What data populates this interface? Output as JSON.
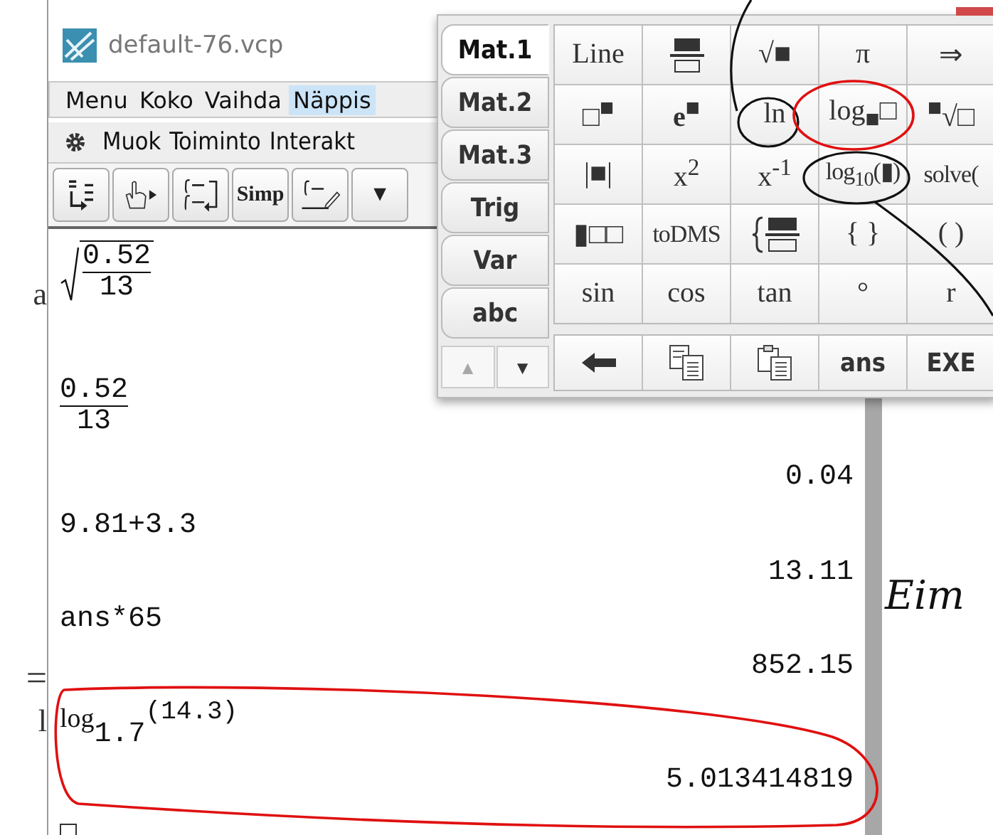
{
  "background_text": [
    {
      "text": "a"
    },
    {
      "text": "="
    },
    {
      "text": "l"
    }
  ],
  "window": {
    "title": "default-76.vcp"
  },
  "menu": [
    {
      "label": "Menu",
      "selected": false
    },
    {
      "label": "Koko",
      "selected": false
    },
    {
      "label": "Vaihda",
      "selected": false
    },
    {
      "label": "Näppis",
      "selected": true
    }
  ],
  "toolbar_menu": [
    "Muok",
    "Toiminto",
    "Interakt"
  ],
  "toolbar": [
    {
      "kind": "convert"
    },
    {
      "kind": "hand"
    },
    {
      "kind": "integral_swap"
    },
    {
      "kind": "text",
      "label": "Simp"
    },
    {
      "kind": "integral_pen"
    },
    {
      "kind": "text",
      "label": "▼"
    }
  ],
  "work_area": [
    {
      "kind": "sqrt_frac",
      "num": "0.52",
      "den": "13"
    },
    {
      "kind": "frac",
      "num": "0.52",
      "den": "13"
    },
    {
      "kind": "result",
      "text": "0.04"
    },
    {
      "kind": "input",
      "text": "9.81+3.3"
    },
    {
      "kind": "result",
      "text": "13.11"
    },
    {
      "kind": "input",
      "text": "ans*65"
    },
    {
      "kind": "result",
      "text": "852.15"
    },
    {
      "kind": "log",
      "base": "1.7",
      "arg": "(14.3)"
    },
    {
      "kind": "result",
      "text": "5.013414819"
    },
    {
      "kind": "cursor"
    }
  ],
  "keyboard": {
    "tabs": [
      {
        "label": "Mat.1",
        "selected": true
      },
      {
        "label": "Mat.2",
        "selected": false
      },
      {
        "label": "Mat.3",
        "selected": false
      },
      {
        "label": "Trig",
        "selected": false
      },
      {
        "label": "Var",
        "selected": false
      },
      {
        "label": "abc",
        "selected": false
      }
    ],
    "scroll": [
      {
        "label": "▲",
        "disabled": true
      },
      {
        "label": "▼",
        "disabled": false
      }
    ],
    "keys": [
      {
        "kind": "math",
        "label": "Line"
      },
      {
        "kind": "fraction"
      },
      {
        "kind": "math",
        "label": "√■"
      },
      {
        "kind": "math",
        "label": "π"
      },
      {
        "kind": "math",
        "label": "⇒"
      },
      {
        "kind": "math",
        "label": "□$^{■}$"
      },
      {
        "kind": "math",
        "label": "**e**$^{■}$"
      },
      {
        "kind": "math",
        "label": "ln"
      },
      {
        "kind": "math",
        "label": "log$_{■}$□"
      },
      {
        "kind": "math",
        "label": "$^{■}$√□"
      },
      {
        "kind": "math",
        "label": "|■|"
      },
      {
        "kind": "math",
        "label": "x$^{2}$"
      },
      {
        "kind": "math",
        "label": "x$^{-1}$"
      },
      {
        "kind": "math",
        "label": "log$_{10}$(▮)"
      },
      {
        "kind": "math",
        "label": "solve("
      },
      {
        "kind": "math",
        "label": "▮□□"
      },
      {
        "kind": "math",
        "label": "toDMS"
      },
      {
        "kind": "brace_fraction"
      },
      {
        "kind": "math",
        "label": "{ }"
      },
      {
        "kind": "math",
        "label": "( )"
      },
      {
        "kind": "math",
        "label": "sin"
      },
      {
        "kind": "math",
        "label": "cos"
      },
      {
        "kind": "math",
        "label": "tan"
      },
      {
        "kind": "math",
        "label": "°"
      },
      {
        "kind": "math",
        "label": "r"
      }
    ],
    "bottom_keys": [
      {
        "kind": "backspace"
      },
      {
        "kind": "copy"
      },
      {
        "kind": "paste"
      },
      {
        "kind": "label",
        "label": "ans"
      },
      {
        "kind": "label",
        "label": "EXE"
      }
    ]
  },
  "handwriting": "Eim"
}
